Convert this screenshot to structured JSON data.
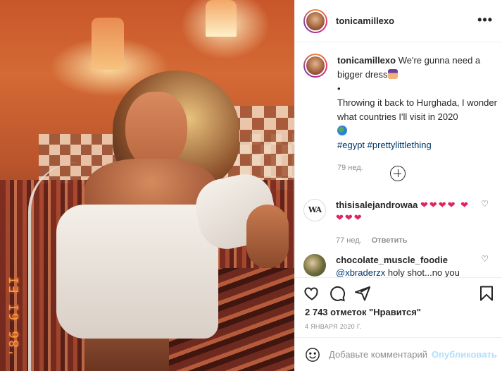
{
  "post": {
    "author": "tonicamillexo",
    "photo_stamp": "'86 6I EI",
    "caption": {
      "username": "tonicamillexo",
      "line1": "We're gunna need a bigger dress",
      "bullet": "•",
      "line2": "Throwing it back to Hurghada, I wonder what countries I'll visit in 2020",
      "hashtag1": "#egypt",
      "hashtag2": "#prettylittlething",
      "time": "79 нед."
    },
    "comments": [
      {
        "username": "thisisalejandrowaa",
        "avatar_text": "WA",
        "text": "❤❤❤❤ ❤❤❤❤",
        "time": "77 нед.",
        "reply_label": "Ответить"
      },
      {
        "username": "chocolate_muscle_foodie",
        "mention": "@xbraderzx",
        "text": "holy shot...no you"
      }
    ],
    "likes": "2 743 отметок \"Нравится\"",
    "date": "4 ЯНВАРЯ 2020 Г.",
    "add_comment_placeholder": "Добавьте комментарий...",
    "publish_label": "Опубликовать"
  },
  "icons": {
    "more": "more-options-icon",
    "like": "heart-icon",
    "comment": "comment-icon",
    "share": "share-icon",
    "save": "bookmark-icon",
    "emoji": "emoji-icon",
    "load_more": "plus-circle-icon"
  },
  "colors": {
    "link": "#00376b",
    "meta": "#8e8e8e",
    "publish_disabled": "#b2dffc",
    "heart": "#e0245e"
  }
}
